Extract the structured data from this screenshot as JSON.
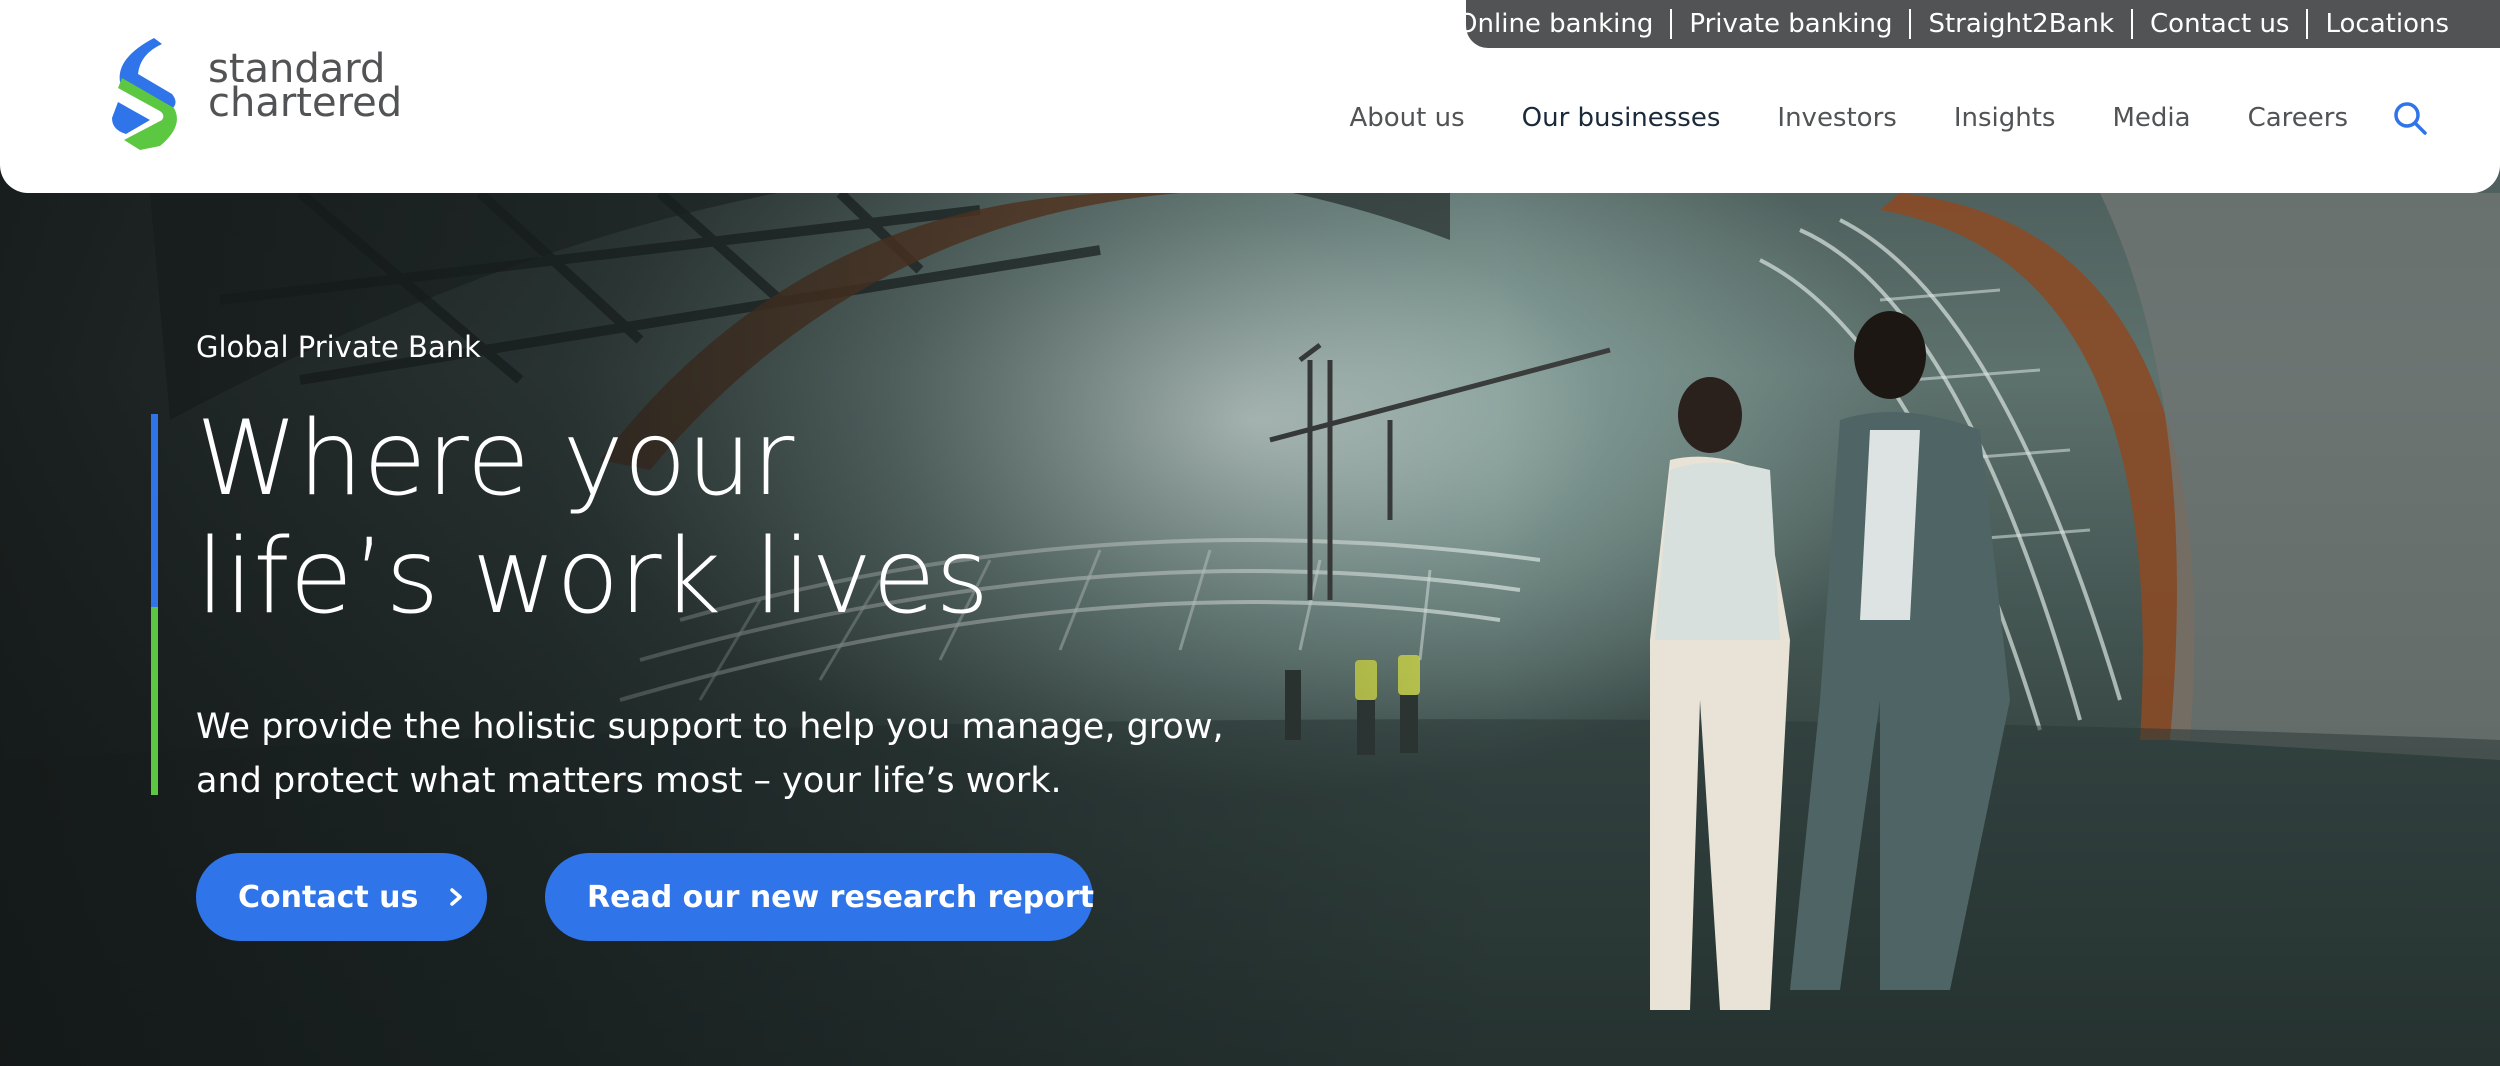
{
  "utility_nav": [
    "Online banking",
    "Private banking",
    "Straight2Bank",
    "Contact us",
    "Locations"
  ],
  "logo": {
    "line1": "standard",
    "line2": "chartered"
  },
  "main_nav": [
    "About us",
    "Our businesses",
    "Investors",
    "Insights",
    "Media",
    "Careers"
  ],
  "hero": {
    "eyebrow": "Global Private Bank",
    "headline_line1": "Where your",
    "headline_line2": "life’s work lives",
    "subtext_line1": "We provide the holistic support to help you manage, grow,",
    "subtext_line2": "and protect what matters most – your life’s work.",
    "cta_primary": "Contact us",
    "cta_secondary": "Read our new research report"
  },
  "colors": {
    "brand_blue": "#2f74e8",
    "brand_green": "#5cc841",
    "utility_bar": "#525355",
    "nav_text": "#525355"
  },
  "icons": {
    "search": "search-icon",
    "chevron": "chevron-right-icon"
  }
}
